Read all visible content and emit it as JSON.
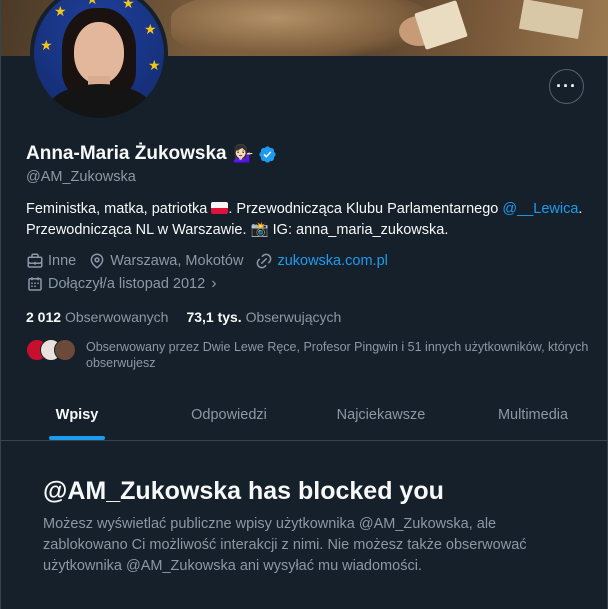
{
  "profile": {
    "name": "Anna-Maria Żukowska",
    "name_emoji": "💁🏻‍♀️",
    "handle": "@AM_Zukowska",
    "bio": {
      "part1": "Feministka, matka, patriotka",
      "part2": ". Przewodnicząca Klubu Parlamentarnego",
      "mention": "@__Lewica",
      "part3": ". Przewodnicząca NL w Warszawie.",
      "camera_emoji": "📸",
      "part4": " IG: anna_maria_zukowska."
    },
    "category": "Inne",
    "location": "Warszawa, Mokotów",
    "website": "zukowska.com.pl",
    "joined": "Dołączył/a listopad 2012",
    "following_count": "2 012",
    "following_label": "Obserwowanych",
    "followers_count": "73,1 tys.",
    "followers_label": "Obserwujących",
    "followed_by": "Obserwowany przez Dwie Lewe Ręce, Profesor Pingwin i 51 innych użytkowników, których obserwujesz"
  },
  "tabs": [
    {
      "label": "Wpisy",
      "active": true
    },
    {
      "label": "Odpowiedzi",
      "active": false
    },
    {
      "label": "Najciekawsze",
      "active": false
    },
    {
      "label": "Multimedia",
      "active": false
    }
  ],
  "blocked": {
    "title": "@AM_Zukowska has blocked you",
    "description": "Możesz wyświetlać publiczne wpisy użytkownika @AM_Zukowska, ale zablokowano Ci możliwość interakcji z nimi. Nie możesz także obserwować użytkownika @AM_Zukowska ani wysyłać mu wiadomości."
  },
  "colors": {
    "background": "#15202b",
    "accent": "#1d9bf0",
    "secondary_text": "#8b98a5"
  }
}
